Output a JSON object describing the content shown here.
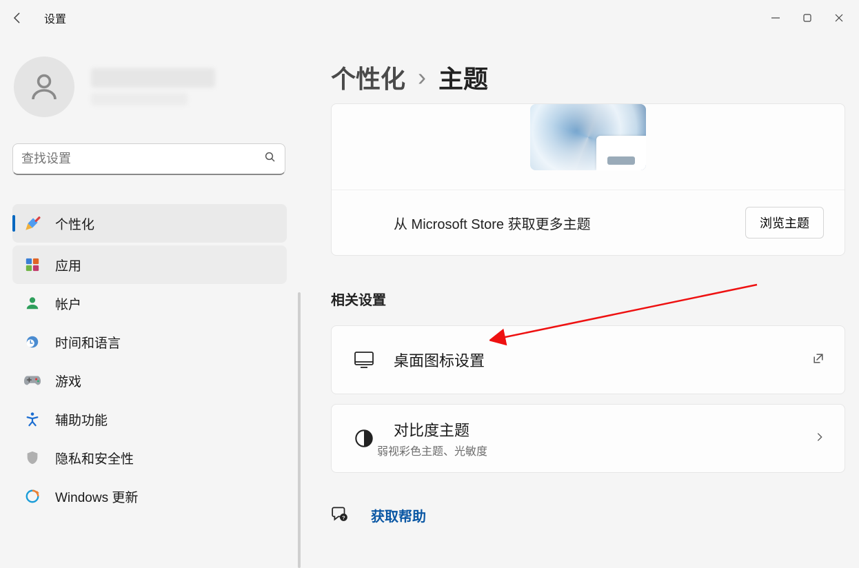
{
  "window": {
    "title": "设置"
  },
  "search": {
    "placeholder": "查找设置"
  },
  "sidebar": {
    "items": [
      {
        "icon": "paintbrush",
        "label": "个性化",
        "active": true
      },
      {
        "icon": "app-tiles",
        "label": "应用",
        "hover": true
      },
      {
        "icon": "person-green",
        "label": "帐户"
      },
      {
        "icon": "clock-globe",
        "label": "时间和语言"
      },
      {
        "icon": "gamepad",
        "label": "游戏"
      },
      {
        "icon": "accessibility",
        "label": "辅助功能"
      },
      {
        "icon": "shield",
        "label": "隐私和安全性"
      },
      {
        "icon": "update",
        "label": "Windows 更新"
      }
    ]
  },
  "breadcrumb": {
    "parent": "个性化",
    "current": "主题"
  },
  "theme": {
    "store_text": "从 Microsoft Store 获取更多主题",
    "browse_button": "浏览主题"
  },
  "related": {
    "heading": "相关设置",
    "desktop_icons": {
      "label": "桌面图标设置"
    },
    "contrast": {
      "label": "对比度主题",
      "sub": "弱视彩色主题、光敏度"
    }
  },
  "help": {
    "link": "获取帮助"
  }
}
